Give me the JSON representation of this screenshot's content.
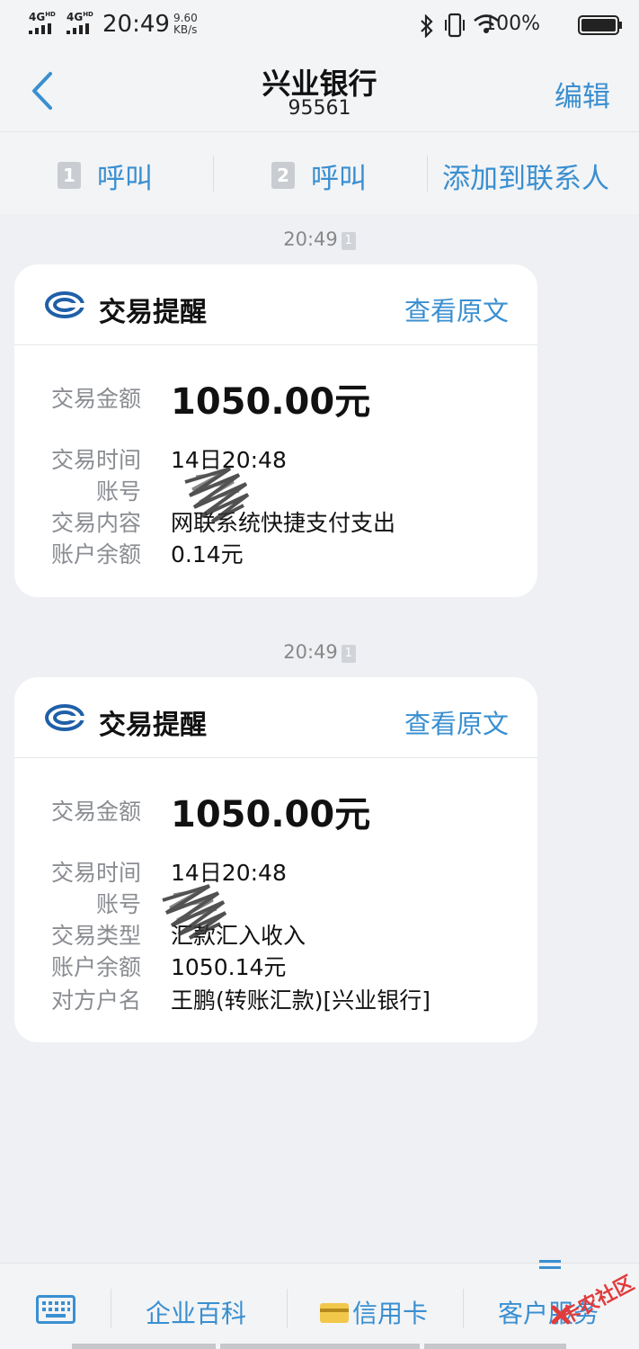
{
  "status_bar": {
    "signal1": "4G",
    "signal2": "4G",
    "time": "20:49",
    "net_speed_value": "9.60",
    "net_speed_unit": "KB/s",
    "battery": "100%"
  },
  "header": {
    "title": "兴业银行",
    "number": "95561",
    "edit_label": "编辑"
  },
  "actions": {
    "sim1_badge": "1",
    "sim1_label": "呼叫",
    "sim2_badge": "2",
    "sim2_label": "呼叫",
    "add_contact": "添加到联系人"
  },
  "messages": [
    {
      "time": "20:49",
      "sim_badge": "1",
      "title": "交易提醒",
      "view_original": "查看原文",
      "rows": [
        {
          "key": "交易金额",
          "value": "1050.00元"
        },
        {
          "key": "交易时间",
          "value": "14日20:48"
        },
        {
          "key": "账号",
          "value": ""
        },
        {
          "key": "交易内容",
          "value": "网联系统快捷支付支出"
        },
        {
          "key": "账户余额",
          "value": "0.14元"
        }
      ]
    },
    {
      "time": "20:49",
      "sim_badge": "1",
      "title": "交易提醒",
      "view_original": "查看原文",
      "rows": [
        {
          "key": "交易金额",
          "value": "1050.00元"
        },
        {
          "key": "交易时间",
          "value": "14日20:48"
        },
        {
          "key": "账号",
          "value": ""
        },
        {
          "key": "交易类型",
          "value": "汇款汇入收入"
        },
        {
          "key": "账户余额",
          "value": "1050.14元"
        },
        {
          "key": "对方户名",
          "value": "王鹏(转账汇款)[兴业银行]"
        }
      ]
    }
  ],
  "bottom_bar": {
    "keyboard_icon": "keyboard-icon",
    "item1": "企业百科",
    "item2": "信用卡",
    "item3": "客户服务"
  },
  "watermark": "卡农社区",
  "colors": {
    "accent": "#3a8fd0",
    "background": "#eef0f3",
    "card": "#ffffff"
  }
}
